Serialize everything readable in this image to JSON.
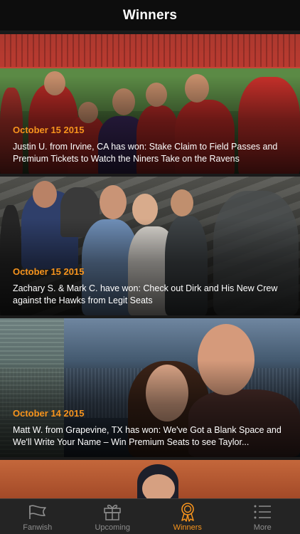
{
  "header": {
    "title": "Winners"
  },
  "winners": [
    {
      "date": "October 15 2015",
      "text": "Justin U. from Irvine, CA has won: Stake Claim to Field Passes and Premium Tickets to Watch the Niners Take on the Ravens"
    },
    {
      "date": "October 15 2015",
      "text": "Zachary S. & Mark C. have won: Check out Dirk and His New Crew against the Hawks from Legit Seats"
    },
    {
      "date": "October 14 2015",
      "text": "Matt W. from Grapevine, TX has won: We've Got a Blank Space and We'll Write Your Name – Win Premium Seats to see Taylor..."
    }
  ],
  "tabs": [
    {
      "label": "Fanwish",
      "icon": "flag-icon",
      "active": false
    },
    {
      "label": "Upcoming",
      "icon": "gift-icon",
      "active": false
    },
    {
      "label": "Winners",
      "icon": "award-ribbon-icon",
      "active": true
    },
    {
      "label": "More",
      "icon": "list-icon",
      "active": false
    }
  ],
  "colors": {
    "accent": "#f7941d",
    "header_bg": "#0d0d0d",
    "tabbar_bg": "#242424",
    "inactive": "#8e8e8e"
  }
}
